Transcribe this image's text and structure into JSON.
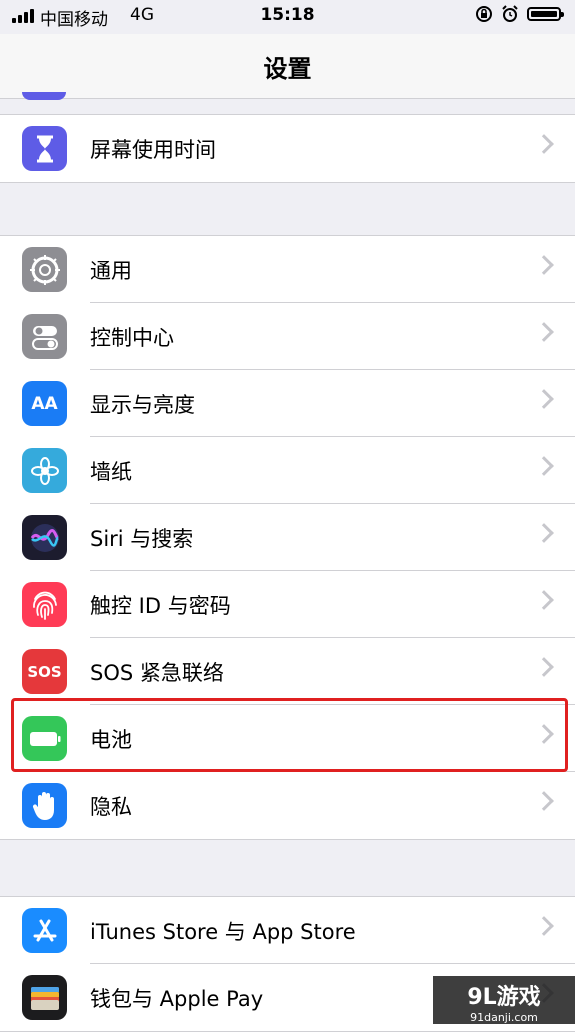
{
  "status_bar": {
    "carrier": "中国移动",
    "network": "4G",
    "time": "15:18"
  },
  "nav": {
    "title": "设置"
  },
  "groups": [
    {
      "items": [
        {
          "label": "屏幕使用时间",
          "icon": "hourglass-icon",
          "color": "#5e5ce6"
        }
      ]
    },
    {
      "items": [
        {
          "label": "通用",
          "icon": "gear-icon",
          "color": "#8e8e93"
        },
        {
          "label": "控制中心",
          "icon": "toggles-icon",
          "color": "#8e8e93"
        },
        {
          "label": "显示与亮度",
          "icon": "text-size-icon",
          "icon_text": "AA",
          "color": "#1a7cf5"
        },
        {
          "label": "墙纸",
          "icon": "flower-icon",
          "color": "#35aadc"
        },
        {
          "label": "Siri 与搜索",
          "icon": "siri-icon",
          "color": "#1c1c2e"
        },
        {
          "label": "触控 ID 与密码",
          "icon": "fingerprint-icon",
          "color": "#ff3b56"
        },
        {
          "label": "SOS 紧急联络",
          "icon": "sos-icon",
          "icon_text": "SOS",
          "color": "#e5383b"
        },
        {
          "label": "电池",
          "icon": "battery-icon",
          "color": "#34c759",
          "highlighted": true
        },
        {
          "label": "隐私",
          "icon": "hand-icon",
          "color": "#1a7cf5"
        }
      ]
    },
    {
      "items": [
        {
          "label": "iTunes Store 与 App Store",
          "icon": "app-store-icon",
          "color": "#1a8cff"
        },
        {
          "label": "钱包与 Apple Pay",
          "icon": "wallet-icon",
          "color": "#1c1c1e"
        }
      ]
    }
  ],
  "watermark": {
    "main": "9L游戏",
    "sub": "91danji.com"
  }
}
